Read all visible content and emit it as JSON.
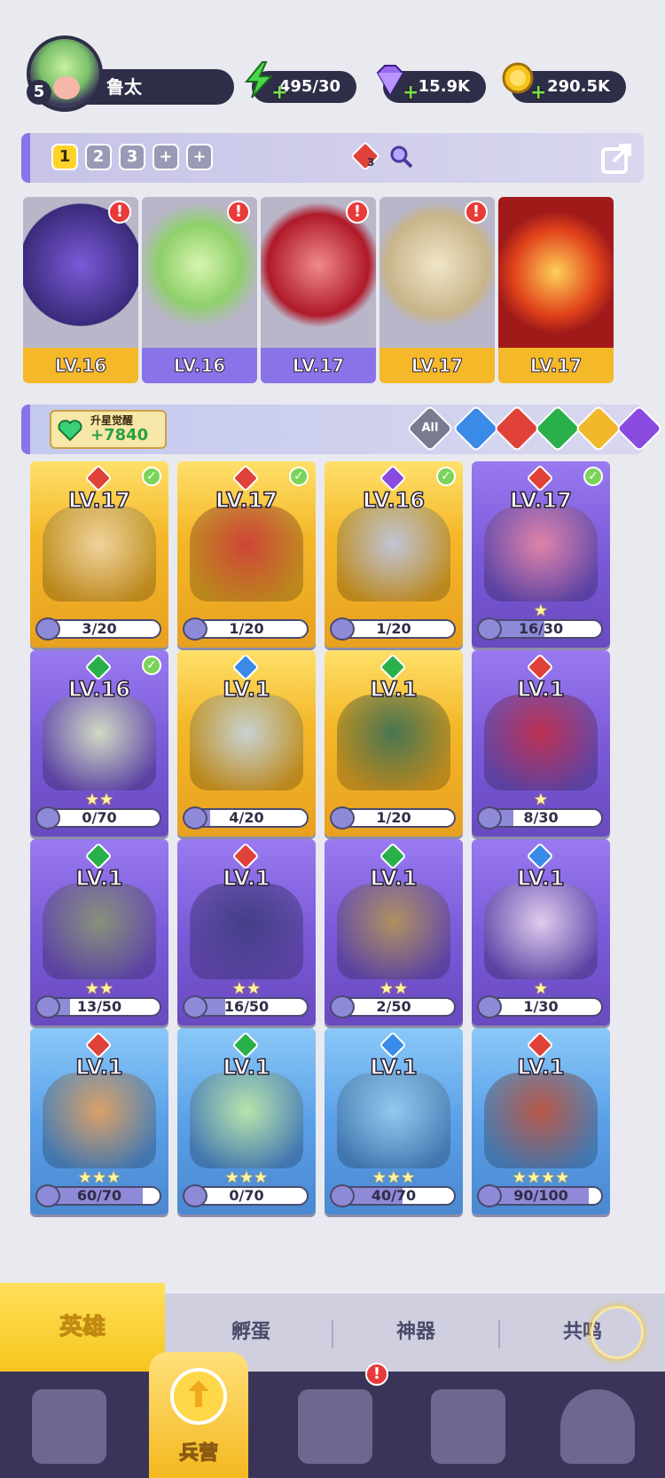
{
  "player": {
    "level": "5",
    "name": "鲁太"
  },
  "resources": [
    {
      "name": "energy-icon",
      "value": "495/30",
      "color": "#4ad84a"
    },
    {
      "name": "gem-icon",
      "value": "15.9K",
      "color": "#9a6af0"
    },
    {
      "name": "coin-icon",
      "value": "290.5K",
      "color": "#f6c21c"
    }
  ],
  "team": {
    "slots": [
      "1",
      "2",
      "3",
      "+",
      "+"
    ],
    "badge_count": "3",
    "cards": [
      {
        "level": "LV.16",
        "element": "dark",
        "alert": "!"
      },
      {
        "level": "LV.16",
        "element": "nature",
        "alert": "!"
      },
      {
        "level": "LV.17",
        "element": "fire",
        "alert": "!"
      },
      {
        "level": "LV.17",
        "element": "fire",
        "alert": "!"
      },
      {
        "level": "LV.17",
        "element": "fire",
        "alert": ""
      }
    ]
  },
  "awaken": {
    "label": "升星觉醒",
    "value": "+7840"
  },
  "filters": [
    "All",
    "water",
    "fire",
    "nature",
    "light",
    "dark"
  ],
  "heroes": [
    {
      "level": "LV.17",
      "element": "fire",
      "progress": "3/20",
      "ratio": 0.15,
      "checked": true,
      "stars": "",
      "bg": "gold"
    },
    {
      "level": "LV.17",
      "element": "fire",
      "progress": "1/20",
      "ratio": 0.05,
      "checked": true,
      "stars": "",
      "bg": "gold"
    },
    {
      "level": "LV.16",
      "element": "dark",
      "progress": "1/20",
      "ratio": 0.05,
      "checked": true,
      "stars": "",
      "bg": "gold"
    },
    {
      "level": "LV.17",
      "element": "fire",
      "progress": "16/30",
      "ratio": 0.53,
      "checked": true,
      "stars": "★",
      "bg": "purple"
    },
    {
      "level": "LV.16",
      "element": "nature",
      "progress": "0/70",
      "ratio": 0.0,
      "checked": true,
      "stars": "★★",
      "bg": "purple"
    },
    {
      "level": "LV.1",
      "element": "water",
      "progress": "4/20",
      "ratio": 0.2,
      "checked": false,
      "stars": "",
      "bg": "gold"
    },
    {
      "level": "LV.1",
      "element": "nature",
      "progress": "1/20",
      "ratio": 0.05,
      "checked": false,
      "stars": "",
      "bg": "gold"
    },
    {
      "level": "LV.1",
      "element": "fire",
      "progress": "8/30",
      "ratio": 0.27,
      "checked": false,
      "stars": "★",
      "bg": "purple"
    },
    {
      "level": "LV.1",
      "element": "nature",
      "progress": "13/50",
      "ratio": 0.26,
      "checked": false,
      "stars": "★★",
      "bg": "purple"
    },
    {
      "level": "LV.1",
      "element": "fire",
      "progress": "16/50",
      "ratio": 0.32,
      "checked": false,
      "stars": "★★",
      "bg": "purple"
    },
    {
      "level": "LV.1",
      "element": "nature",
      "progress": "2/50",
      "ratio": 0.04,
      "checked": false,
      "stars": "★★",
      "bg": "purple"
    },
    {
      "level": "LV.1",
      "element": "water",
      "progress": "1/30",
      "ratio": 0.03,
      "checked": false,
      "stars": "★",
      "bg": "purple"
    },
    {
      "level": "LV.1",
      "element": "fire",
      "progress": "60/70",
      "ratio": 0.86,
      "checked": false,
      "stars": "★★★",
      "bg": "blue"
    },
    {
      "level": "LV.1",
      "element": "nature",
      "progress": "0/70",
      "ratio": 0.0,
      "checked": false,
      "stars": "★★★",
      "bg": "blue"
    },
    {
      "level": "LV.1",
      "element": "water",
      "progress": "40/70",
      "ratio": 0.57,
      "checked": false,
      "stars": "★★★",
      "bg": "blue"
    },
    {
      "level": "LV.1",
      "element": "fire",
      "progress": "90/100",
      "ratio": 0.9,
      "checked": false,
      "stars": "★★★★",
      "bg": "blue"
    }
  ],
  "tabs": [
    "英雄",
    "孵蛋",
    "神器",
    "共鸣"
  ],
  "nav": {
    "active_label": "兵营",
    "alert": "!"
  }
}
